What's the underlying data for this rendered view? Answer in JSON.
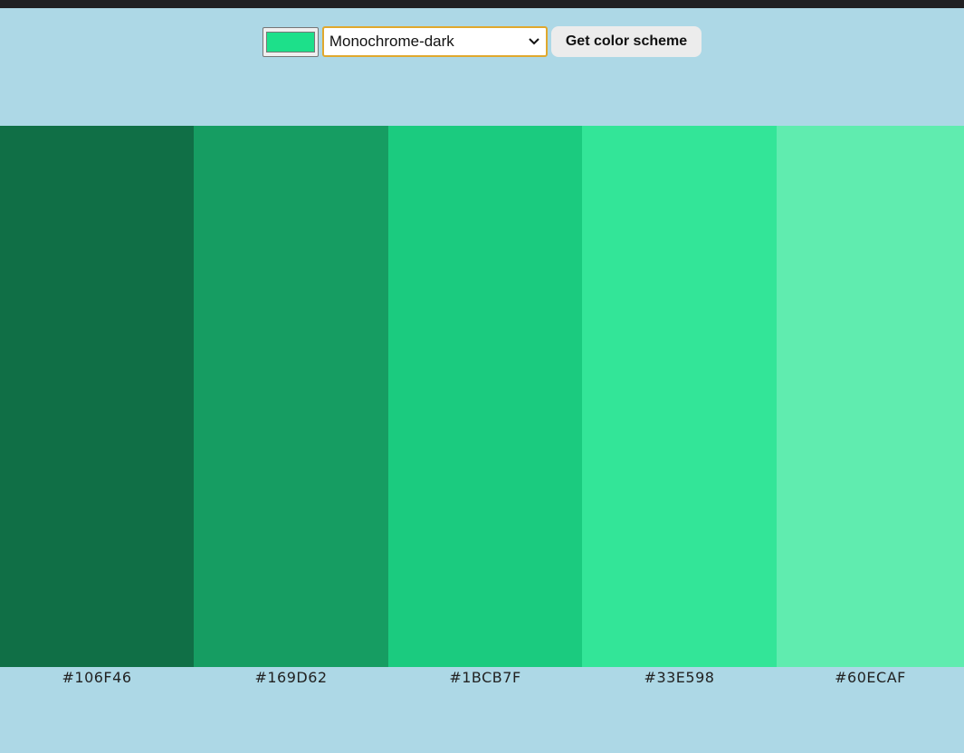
{
  "controls": {
    "seed_color": "#1DE08A",
    "mode_selected": "Monochrome-dark",
    "button_label": "Get color scheme"
  },
  "scheme": {
    "colors": [
      {
        "hex": "#106F46"
      },
      {
        "hex": "#169D62"
      },
      {
        "hex": "#1BCB7F"
      },
      {
        "hex": "#33E598"
      },
      {
        "hex": "#60ECAF"
      }
    ]
  },
  "theme": {
    "page_background": "#ADD8E6",
    "topbar": "#202124",
    "select_focus_border": "#E0A82E"
  },
  "icons": {
    "select_arrow": "chevron-down-icon"
  }
}
